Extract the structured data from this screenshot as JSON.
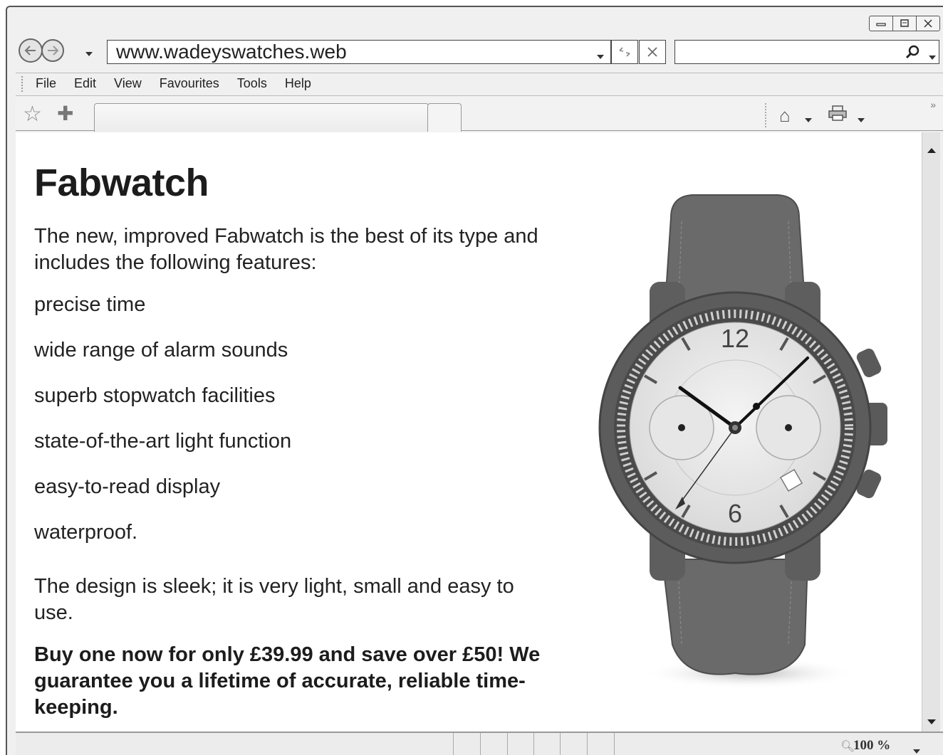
{
  "browser": {
    "url": "www.wadeyswatches.web",
    "search_placeholder": "",
    "menu": [
      "File",
      "Edit",
      "View",
      "Favourites",
      "Tools",
      "Help"
    ],
    "zoom": "100 %"
  },
  "page": {
    "title": "Fabwatch",
    "intro": "The new, improved Fabwatch is the best of its type and includes the following features:",
    "features": [
      "precise time",
      "wide range of alarm sounds",
      "superb stopwatch facilities",
      "state-of-the-art light function",
      "easy-to-read display",
      "waterproof."
    ],
    "design": "The design is sleek; it is very light, small and easy to use.",
    "offer": "Buy one now for only £39.99 and save over £50! We guarantee you a lifetime of accurate, reliable time-keeping."
  },
  "icons": {
    "back": "back-arrow-icon",
    "forward": "forward-arrow-icon",
    "refresh": "refresh-icon",
    "stop": "stop-icon",
    "search": "search-icon",
    "favorites": "star-icon",
    "add_favorite": "add-favorite-icon",
    "home": "home-icon",
    "print": "print-icon",
    "zoom": "zoom-icon"
  }
}
